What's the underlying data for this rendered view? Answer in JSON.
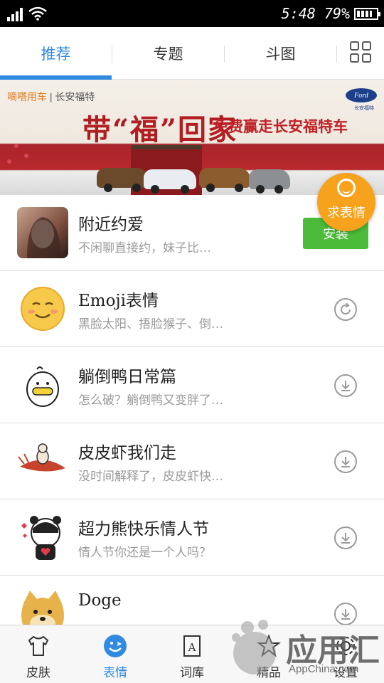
{
  "status_bar": {
    "time": "5:48",
    "battery": "79%",
    "icons": [
      "signal-icon",
      "wifi-icon",
      "battery-icon"
    ]
  },
  "tabs": [
    {
      "label": "推荐",
      "active": true
    },
    {
      "label": "专题",
      "active": false
    },
    {
      "label": "斗图",
      "active": false
    }
  ],
  "grid_icon": "grid-icon",
  "banner": {
    "brand": "嘀嗒用车",
    "brand_sub": "| 长安福特",
    "headline": "带“福”回家",
    "promo": "免费赢走长安福特车",
    "logo": "Ford",
    "logo_sub": "长安福特"
  },
  "fab": {
    "label": "求表情",
    "icon": "smile-icon"
  },
  "items": [
    {
      "title": "附近约爱",
      "desc": "不闲聊直接约，妹子比…",
      "action": "安装",
      "action_type": "install"
    },
    {
      "title": "Emoji表情",
      "desc": "黑脸太阳、捂脸猴子、倒…",
      "action_type": "refresh",
      "action_icon": "refresh-icon"
    },
    {
      "title": "躺倒鸭日常篇",
      "desc": "怎么破？躺倒鸭又变胖了…",
      "action_type": "download",
      "action_icon": "download-icon"
    },
    {
      "title": "皮皮虾我们走",
      "desc": "没时间解释了，皮皮虾快…",
      "action_type": "download",
      "action_icon": "download-icon"
    },
    {
      "title": "超力熊快乐情人节",
      "desc": "情人节你还是一个人吗？",
      "action_type": "download",
      "action_icon": "download-icon"
    },
    {
      "title": "Doge",
      "desc": "",
      "action_type": "download",
      "action_icon": "download-icon"
    }
  ],
  "bottom_nav": [
    {
      "label": "皮肤",
      "icon": "shirt-icon",
      "active": false
    },
    {
      "label": "表情",
      "icon": "emoji-icon",
      "active": true
    },
    {
      "label": "词库",
      "icon": "book-icon",
      "active": false
    },
    {
      "label": "精品",
      "icon": "star-icon",
      "active": false
    },
    {
      "label": "设置",
      "icon": "gear-icon",
      "active": false
    }
  ],
  "watermark": {
    "text": "应用汇",
    "sub": "AppChina.com"
  },
  "colors": {
    "accent": "#2f8ae0",
    "install": "#4cbb3a",
    "fab": "#f7a21c",
    "banner_red": "#b01e22"
  }
}
